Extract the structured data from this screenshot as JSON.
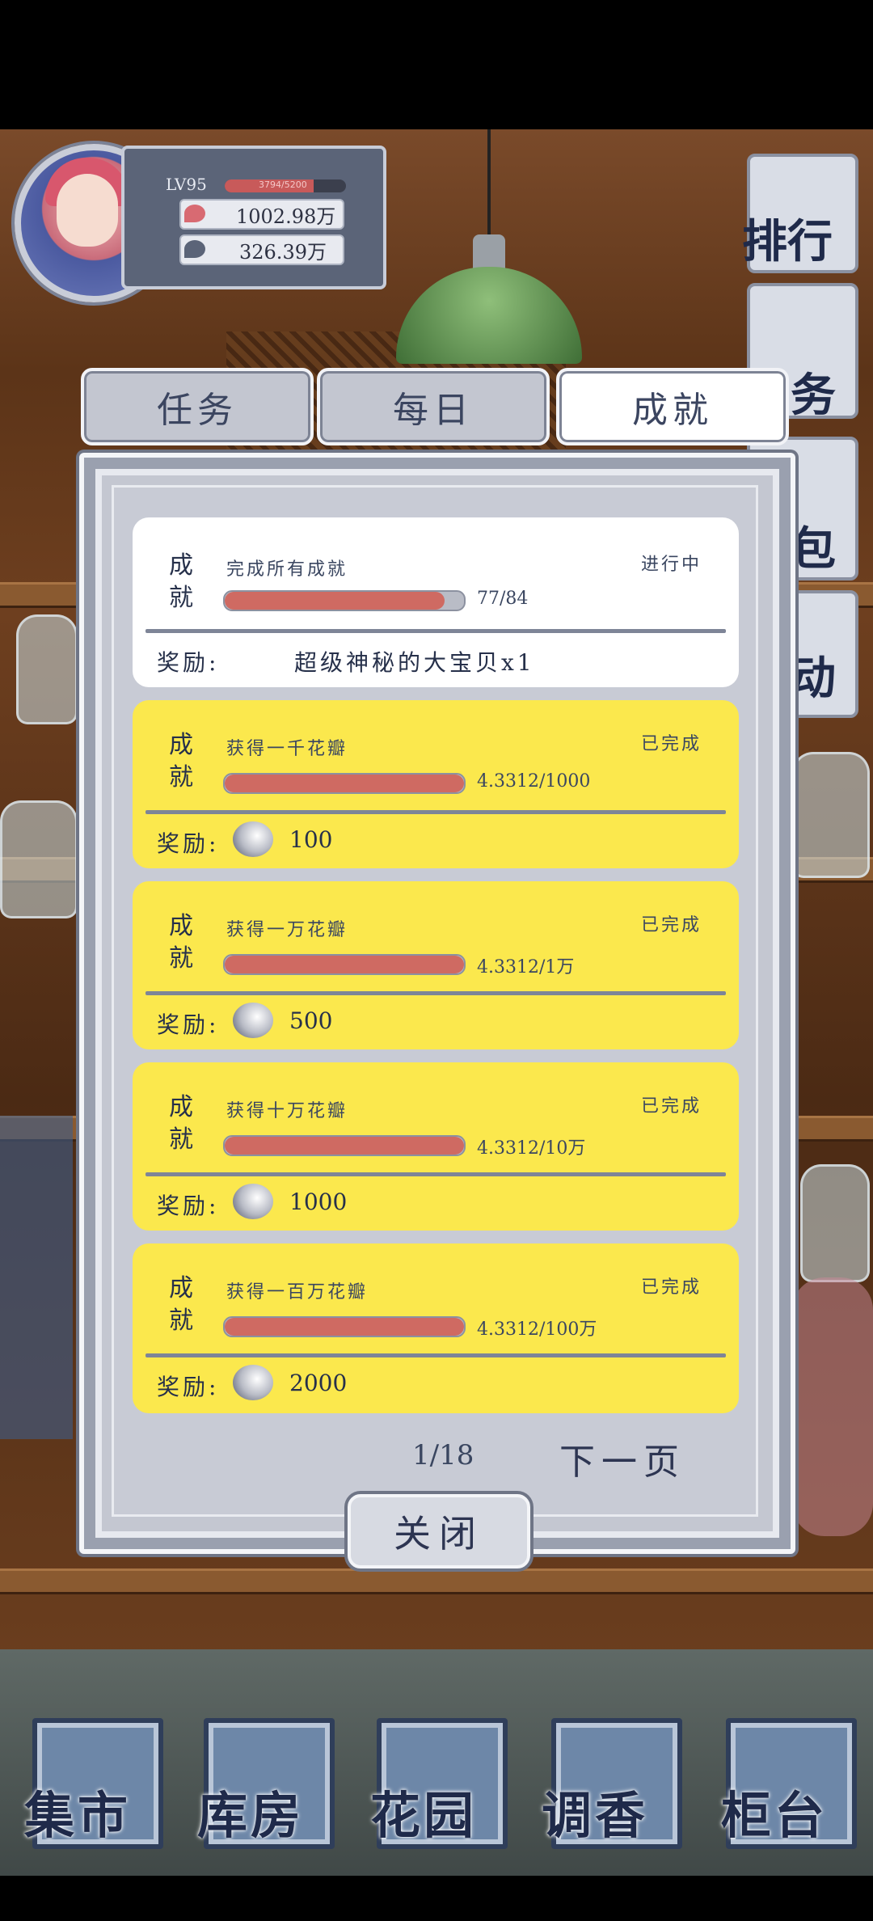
{
  "player": {
    "level": "LV95",
    "xp_text": "3794/5200",
    "xp_fraction": 0.73,
    "currency_red": "1002.98万",
    "currency_grey": "326.39万"
  },
  "side_menu": [
    {
      "label": "排行"
    },
    {
      "label": "务"
    },
    {
      "label": "包"
    },
    {
      "label": "动"
    }
  ],
  "tabs": [
    {
      "label": "任务",
      "active": false
    },
    {
      "label": "每日",
      "active": false
    },
    {
      "label": "成就",
      "active": true
    }
  ],
  "achievements": [
    {
      "category_top": "成",
      "category_bottom": "就",
      "title": "完成所有成就",
      "status": "进行中",
      "progress_text": "77/84",
      "progress_fraction": 0.92,
      "reward_label": "奖励:",
      "reward_text": "超级神秘的大宝贝x1",
      "style": "white"
    },
    {
      "category_top": "成",
      "category_bottom": "就",
      "title": "获得一千花瓣",
      "status": "已完成",
      "progress_text": "4.3312/1000",
      "progress_fraction": 1.0,
      "reward_label": "奖励:",
      "reward_amount": "100",
      "style": "yellow"
    },
    {
      "category_top": "成",
      "category_bottom": "就",
      "title": "获得一万花瓣",
      "status": "已完成",
      "progress_text": "4.3312/1万",
      "progress_fraction": 1.0,
      "reward_label": "奖励:",
      "reward_amount": "500",
      "style": "yellow"
    },
    {
      "category_top": "成",
      "category_bottom": "就",
      "title": "获得十万花瓣",
      "status": "已完成",
      "progress_text": "4.3312/10万",
      "progress_fraction": 1.0,
      "reward_label": "奖励:",
      "reward_amount": "1000",
      "style": "yellow"
    },
    {
      "category_top": "成",
      "category_bottom": "就",
      "title": "获得一百万花瓣",
      "status": "已完成",
      "progress_text": "4.3312/100万",
      "progress_fraction": 1.0,
      "reward_label": "奖励:",
      "reward_amount": "2000",
      "style": "yellow"
    }
  ],
  "pager": {
    "page": "1/18",
    "next_label": "下一页"
  },
  "close_label": "关闭",
  "bottom_nav": [
    {
      "label": "集市"
    },
    {
      "label": "库房"
    },
    {
      "label": "花园"
    },
    {
      "label": "调香"
    },
    {
      "label": "柜台"
    }
  ],
  "colors": {
    "card_yellow": "#fbe84d",
    "progress_red": "#cf6a62",
    "dialog_grey": "#c4c7d1"
  }
}
